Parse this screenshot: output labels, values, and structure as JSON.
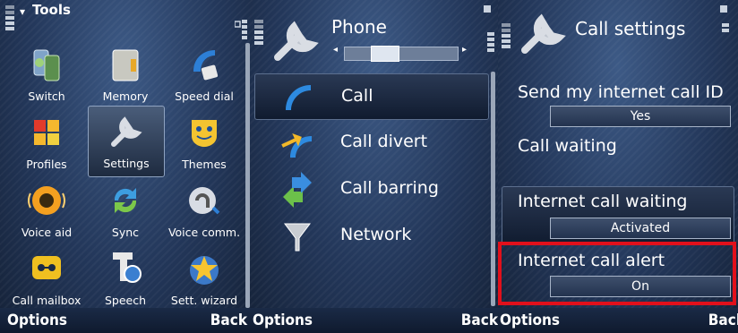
{
  "screen1": {
    "title": "Tools",
    "apps": [
      {
        "label": "Switch",
        "icon": "switch-icon"
      },
      {
        "label": "Memory",
        "icon": "memory-icon"
      },
      {
        "label": "Speed dial",
        "icon": "speed-dial-icon"
      },
      {
        "label": "Profiles",
        "icon": "profiles-icon"
      },
      {
        "label": "Settings",
        "icon": "settings-icon",
        "selected": true
      },
      {
        "label": "Themes",
        "icon": "themes-icon"
      },
      {
        "label": "Voice aid",
        "icon": "voice-aid-icon"
      },
      {
        "label": "Sync",
        "icon": "sync-icon"
      },
      {
        "label": "Voice comm.",
        "icon": "voice-comm-icon"
      },
      {
        "label": "Call mailbox",
        "icon": "call-mailbox-icon"
      },
      {
        "label": "Speech",
        "icon": "speech-icon"
      },
      {
        "label": "Sett. wizard",
        "icon": "settings-wizard-icon"
      }
    ],
    "softkeys": {
      "left": "Options",
      "right": "Back"
    }
  },
  "screen2": {
    "title": "Phone",
    "items": [
      {
        "label": "Call",
        "icon": "call-icon",
        "selected": true
      },
      {
        "label": "Call divert",
        "icon": "call-divert-icon"
      },
      {
        "label": "Call barring",
        "icon": "call-barring-icon"
      },
      {
        "label": "Network",
        "icon": "network-icon"
      }
    ],
    "softkeys": {
      "left": "Options",
      "right": "Back"
    }
  },
  "screen3": {
    "title": "Call settings",
    "settings": [
      {
        "label": "Send my internet call ID",
        "value": "Yes"
      },
      {
        "label": "Call waiting",
        "value": ""
      },
      {
        "label": "Internet call waiting",
        "value": "Activated",
        "selected": true
      },
      {
        "label": "Internet call alert",
        "value": "On",
        "highlighted": true
      }
    ],
    "softkeys": {
      "left": "Options",
      "right": "Back"
    }
  },
  "colors": {
    "highlight_border": "#e1101b",
    "background": "#23375a",
    "text": "#ffffff"
  }
}
